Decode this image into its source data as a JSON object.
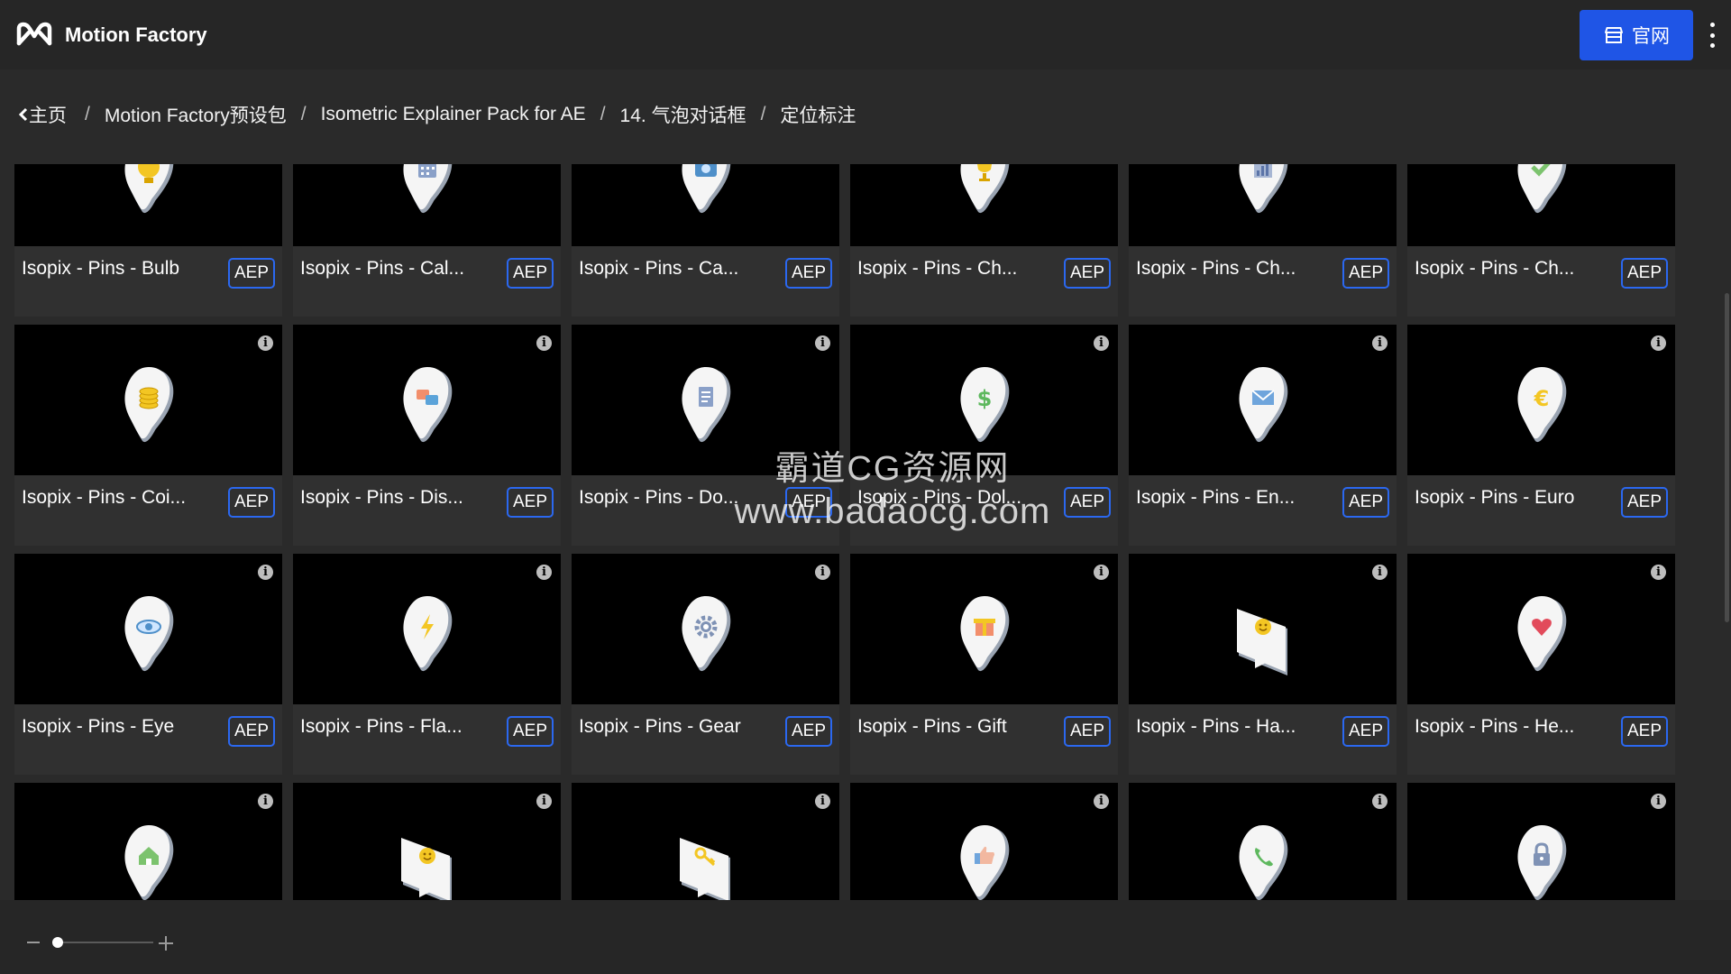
{
  "app": {
    "title": "Motion Factory"
  },
  "header": {
    "site_button_label": "官网"
  },
  "breadcrumb": [
    "主页",
    "Motion Factory预设包",
    "Isometric Explainer Pack for AE",
    "14. 气泡对话框",
    "定位标注"
  ],
  "cards": [
    {
      "name": "Isopix - Pins - Bulb",
      "badge": "AEP",
      "icon": "lightbulb",
      "shape": "pin"
    },
    {
      "name": "Isopix - Pins - Cal...",
      "badge": "AEP",
      "icon": "calendar",
      "shape": "pin"
    },
    {
      "name": "Isopix - Pins - Ca...",
      "badge": "AEP",
      "icon": "camera",
      "shape": "pin"
    },
    {
      "name": "Isopix - Pins - Ch...",
      "badge": "AEP",
      "icon": "trophy",
      "shape": "pin"
    },
    {
      "name": "Isopix - Pins - Ch...",
      "badge": "AEP",
      "icon": "bar-chart",
      "shape": "pin"
    },
    {
      "name": "Isopix - Pins - Ch...",
      "badge": "AEP",
      "icon": "checkmark",
      "shape": "pin"
    },
    {
      "name": "Isopix - Pins - Coi...",
      "badge": "AEP",
      "icon": "coins",
      "shape": "pin"
    },
    {
      "name": "Isopix - Pins - Dis...",
      "badge": "AEP",
      "icon": "discussion",
      "shape": "pin"
    },
    {
      "name": "Isopix - Pins - Do...",
      "badge": "AEP",
      "icon": "document",
      "shape": "pin"
    },
    {
      "name": "Isopix - Pins - Dol...",
      "badge": "AEP",
      "icon": "dollar",
      "shape": "pin"
    },
    {
      "name": "Isopix - Pins - En...",
      "badge": "AEP",
      "icon": "envelope",
      "shape": "pin"
    },
    {
      "name": "Isopix - Pins - Euro",
      "badge": "AEP",
      "icon": "euro",
      "shape": "pin"
    },
    {
      "name": "Isopix - Pins - Eye",
      "badge": "AEP",
      "icon": "eye",
      "shape": "pin"
    },
    {
      "name": "Isopix - Pins - Fla...",
      "badge": "AEP",
      "icon": "flash",
      "shape": "pin"
    },
    {
      "name": "Isopix - Pins - Gear",
      "badge": "AEP",
      "icon": "gear",
      "shape": "pin"
    },
    {
      "name": "Isopix - Pins - Gift",
      "badge": "AEP",
      "icon": "gift",
      "shape": "pin"
    },
    {
      "name": "Isopix - Pins - Ha...",
      "badge": "AEP",
      "icon": "smiley",
      "shape": "square"
    },
    {
      "name": "Isopix - Pins - He...",
      "badge": "AEP",
      "icon": "heart",
      "shape": "pin"
    },
    {
      "name": "",
      "badge": "",
      "icon": "house",
      "shape": "pin"
    },
    {
      "name": "",
      "badge": "",
      "icon": "smiley",
      "shape": "square"
    },
    {
      "name": "",
      "badge": "",
      "icon": "key",
      "shape": "square"
    },
    {
      "name": "",
      "badge": "",
      "icon": "thumbs-up",
      "shape": "pin"
    },
    {
      "name": "",
      "badge": "",
      "icon": "phone",
      "shape": "pin"
    },
    {
      "name": "",
      "badge": "",
      "icon": "padlock",
      "shape": "pin"
    }
  ],
  "watermark": {
    "line1": "霸道CG资源网",
    "line2": "www.badaocg.com"
  },
  "zoom": {
    "level": 0.05
  },
  "colors": {
    "accent": "#1f55e6",
    "badge_border": "#2b68f0",
    "background": "#2a2a2a",
    "thumb_bg": "#000000"
  }
}
